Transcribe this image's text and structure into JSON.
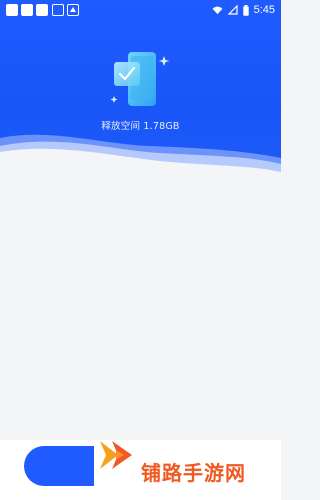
{
  "status_bar": {
    "time": "5:45",
    "icons": [
      "notification-icon",
      "notification-icon",
      "notification-icon",
      "notification-icon",
      "notification-icon",
      "wifi-icon",
      "signal-icon",
      "battery-icon"
    ]
  },
  "hero": {
    "caption": "释放空间 1.78GB",
    "illustration": "phone-check-icon"
  },
  "colors": {
    "brand_blue": "#1f5bff",
    "background": "#f4f5f7",
    "watermark": "#f05a22"
  },
  "watermark": {
    "text": "铺路手游网"
  }
}
